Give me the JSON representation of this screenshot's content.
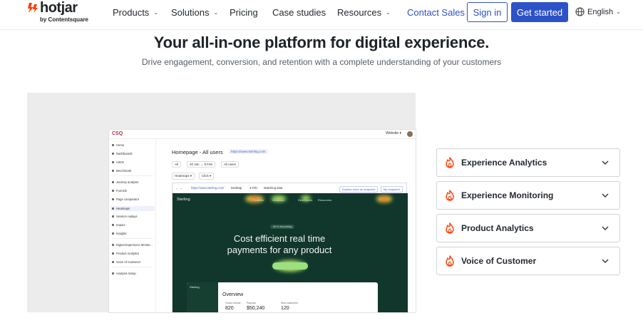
{
  "nav": {
    "logo_text": "hotjar",
    "logo_sub": "by Contentsquare",
    "links": [
      {
        "label": "Products",
        "has_caret": true
      },
      {
        "label": "Solutions",
        "has_caret": true
      },
      {
        "label": "Pricing",
        "has_caret": false
      },
      {
        "label": "Case studies",
        "has_caret": false
      },
      {
        "label": "Resources",
        "has_caret": true
      }
    ],
    "contact_label": "Contact Sales",
    "signin_label": "Sign in",
    "start_label": "Get started",
    "language": "English",
    "accent_color": "#2d52c8",
    "logo_color": "#ff3c00"
  },
  "hero": {
    "title": "Your all-in-one platform for digital experience.",
    "subtitle": "Drive engagement, conversion, and retention with a complete understanding of your customers"
  },
  "app": {
    "brand": "CSQ",
    "topbar": "Website ▾",
    "sidebar": [
      "Home",
      "Dashboards",
      "Alerts",
      "Benchmark",
      "Journey analysis",
      "Funnels",
      "Page comparator",
      "Heatmaps",
      "Session replays",
      "Impact",
      "Insights",
      "Digital Experience Monito...",
      "Product Analytics",
      "Voice of Customer",
      "Analysis Setup"
    ],
    "active_item": "Heatmaps",
    "page_title": "Homepage - All users",
    "page_url": "https://www.sterling.com",
    "filters": [
      "All",
      "20 Jan → 8 Feb",
      "All users"
    ],
    "filters2": [
      "Heatmaps ▾",
      "Click ▾"
    ],
    "heat_url": "https://www.sterling.com/",
    "heat_device": "Desktop",
    "heat_count": "3 Feb",
    "heat_matching": "Matching data",
    "heat_btn1": "Explore more as snapshot",
    "heat_btn2": "My snapshot",
    "site": {
      "logo": "Sterling",
      "nav": [
        "Products",
        "Solutions",
        "Developers",
        "Resources"
      ],
      "pill": "All in real pricing",
      "headline_1": "Cost efficient real time",
      "headline_2": "payments for any product"
    },
    "dashboard": {
      "logo": "Sterling",
      "title": "Overview",
      "kpis": [
        {
          "label": "Gross volume",
          "value": "820"
        },
        {
          "label": "Payouts",
          "value": "$50,240"
        },
        {
          "label": "New customers",
          "value": "120"
        }
      ]
    }
  },
  "accordion": [
    {
      "label": "Experience Analytics",
      "icon": "flame-icon"
    },
    {
      "label": "Experience Monitoring",
      "icon": "flame-icon"
    },
    {
      "label": "Product Analytics",
      "icon": "flame-icon"
    },
    {
      "label": "Voice of Customer",
      "icon": "flame-icon"
    }
  ]
}
